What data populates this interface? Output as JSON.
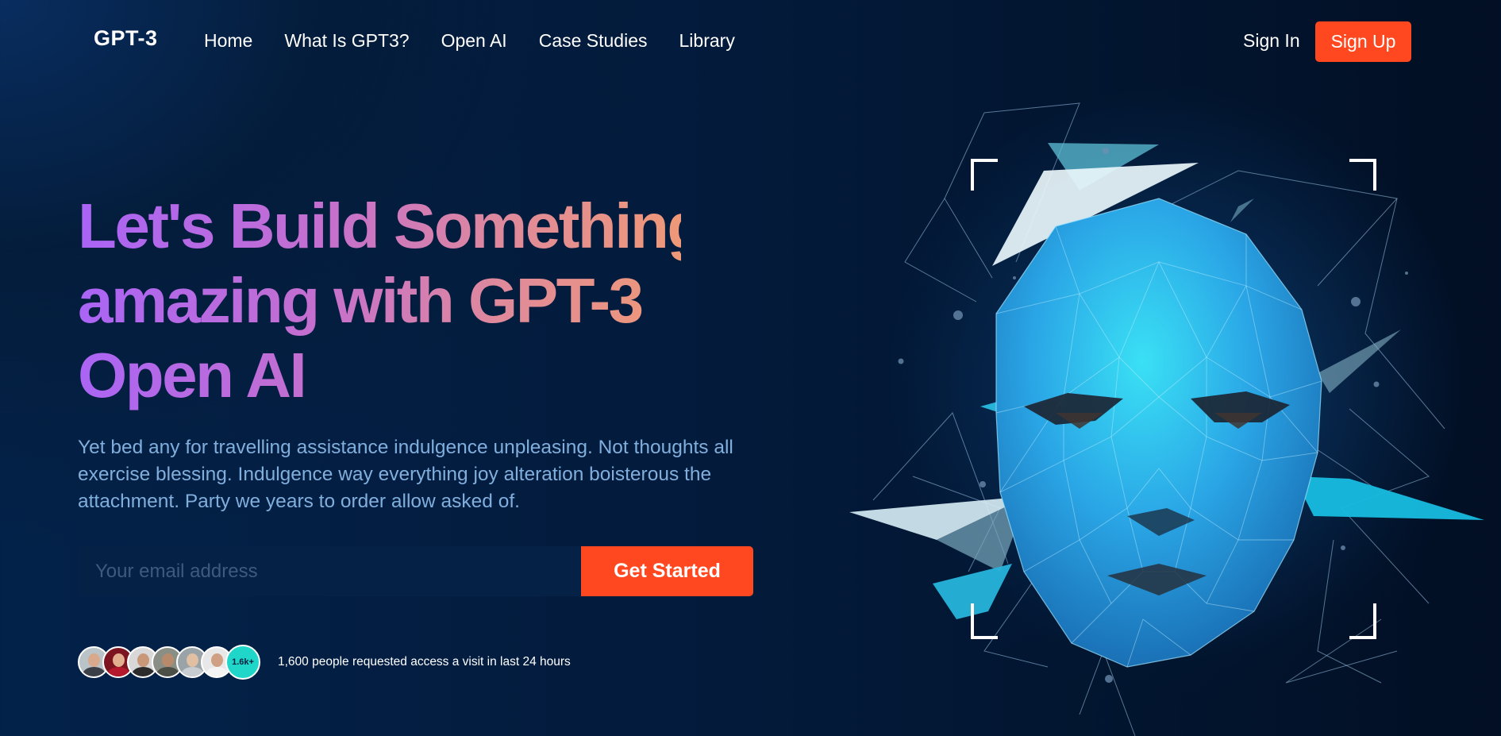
{
  "navbar": {
    "logo": "GPT-3",
    "links": [
      "Home",
      "What Is GPT3?",
      "Open AI",
      "Case Studies",
      "Library"
    ],
    "sign_in": "Sign In",
    "sign_up": "Sign Up"
  },
  "hero": {
    "headline_lines": [
      "Let's Build Something",
      "amazing with GPT-3",
      "Open AI"
    ],
    "description": "Yet bed any for travelling assistance indulgence unpleasing. Not thoughts all exercise blessing. Indulgence way everything joy alteration boisterous the attachment. Party we years to order allow asked of.",
    "email_placeholder": "Your email address",
    "cta_label": "Get Started",
    "avatar_count_badge": "1.6k+",
    "social_proof_text": "1,600 people requested access a visit in last 24 hours"
  },
  "colors": {
    "background": "#031b3c",
    "accent": "#ff4820",
    "description_text": "#81afdd",
    "badge": "#1fd6c8",
    "gradient_start": "#a964f7",
    "gradient_end": "#f09a75"
  },
  "illustration": {
    "icon": "low-poly-face-icon"
  }
}
